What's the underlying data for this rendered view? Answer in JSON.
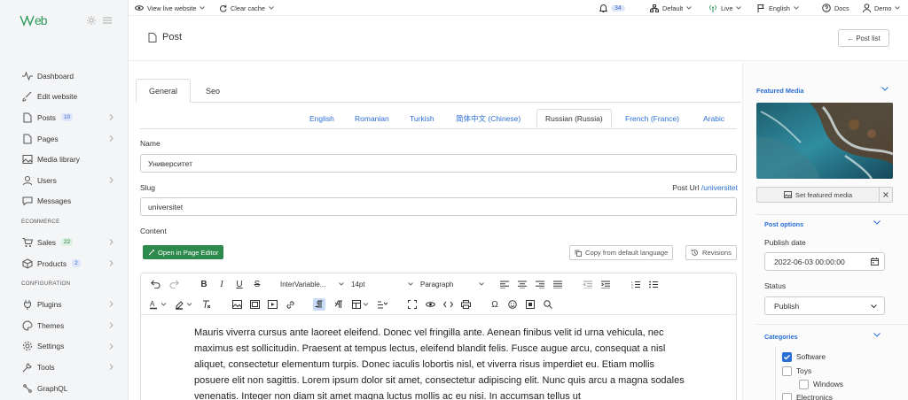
{
  "brand": {
    "logo": "\\\\\\eb"
  },
  "sidebar": {
    "items": [
      {
        "label": "Dashboard",
        "icon": "activity-icon"
      },
      {
        "label": "Edit website",
        "icon": "brush-icon"
      },
      {
        "label": "Posts",
        "icon": "document-icon",
        "badge": "10",
        "chevron": true
      },
      {
        "label": "Pages",
        "icon": "document-icon",
        "chevron": true
      },
      {
        "label": "Media library",
        "icon": "image-icon"
      },
      {
        "label": "Users",
        "icon": "users-icon",
        "chevron": true
      },
      {
        "label": "Messages",
        "icon": "message-icon"
      }
    ],
    "section_ecommerce": "ECOMMERCE",
    "ecommerce_items": [
      {
        "label": "Sales",
        "icon": "cart-icon",
        "badge": "22",
        "chevron": true
      },
      {
        "label": "Products",
        "icon": "box-icon",
        "badge": "2",
        "chevron": true
      }
    ],
    "section_configuration": "CONFIGURATION",
    "config_items": [
      {
        "label": "Plugins",
        "icon": "plug-icon",
        "chevron": true
      },
      {
        "label": "Themes",
        "icon": "palette-icon",
        "chevron": true
      },
      {
        "label": "Settings",
        "icon": "gear-icon",
        "chevron": true
      },
      {
        "label": "Tools",
        "icon": "wrench-icon",
        "chevron": true
      },
      {
        "label": "GraphQL",
        "icon": "graph-icon"
      }
    ]
  },
  "topbar": {
    "view_live": "View live website",
    "clear_cache": "Clear cache",
    "notifications": "34",
    "theme": "Default",
    "status": "Live",
    "language": "English",
    "docs": "Docs",
    "user": "Demo"
  },
  "header": {
    "title": "Post",
    "post_list": "Post list"
  },
  "tabs": {
    "general": "General",
    "seo": "Seo"
  },
  "languages": [
    "English",
    "Romanian",
    "Turkish",
    "简体中文 (Chinese)",
    "Russian (Russia)",
    "French (France)",
    "Arabic"
  ],
  "form": {
    "name_label": "Name",
    "name_value": "Университет",
    "slug_label": "Slug",
    "post_url_label": "Post Url",
    "post_url_link": "/universitet",
    "slug_value": "universitet",
    "content_label": "Content",
    "open_page_editor": "Open in Page Editor",
    "copy_default": "Copy from default language",
    "revisions": "Revisions"
  },
  "editor": {
    "font_family": "InterVariable...",
    "font_size": "14pt",
    "block_format": "Paragraph",
    "body": "Mauris viverra cursus ante laoreet eleifend. Donec vel fringilla ante. Aenean finibus velit id urna vehicula, nec maximus est sollicitudin. Praesent at tempus lectus, eleifend blandit felis. Fusce augue arcu, consequat a nisl aliquet, consectetur elementum turpis. Donec iaculis lobortis nisl, et viverra risus imperdiet eu. Etiam mollis posuere elit non sagittis. Lorem ipsum dolor sit amet, consectetur adipiscing elit. Nunc quis arcu a magna sodales venenatis. Integer non diam sit amet magna luctus mollis ac eu nisi. In accumsan tellus ut"
  },
  "right_panel": {
    "featured_media": "Featured Media",
    "set_featured": "Set featured media",
    "post_options": "Post options",
    "publish_date_label": "Publish date",
    "publish_date_value": "2022-06-03 00:00:00",
    "status_label": "Status",
    "status_value": "Publish",
    "categories": "Categories",
    "category_items": [
      {
        "label": "Software",
        "checked": true
      },
      {
        "label": "Toys",
        "checked": false
      },
      {
        "label": "Windows",
        "checked": false
      },
      {
        "label": "Electronics",
        "checked": false
      }
    ]
  },
  "colors": {
    "accent": "#2a6fd6",
    "brand_green": "#2c9a5a",
    "editor_button": "#2c8a4c"
  }
}
